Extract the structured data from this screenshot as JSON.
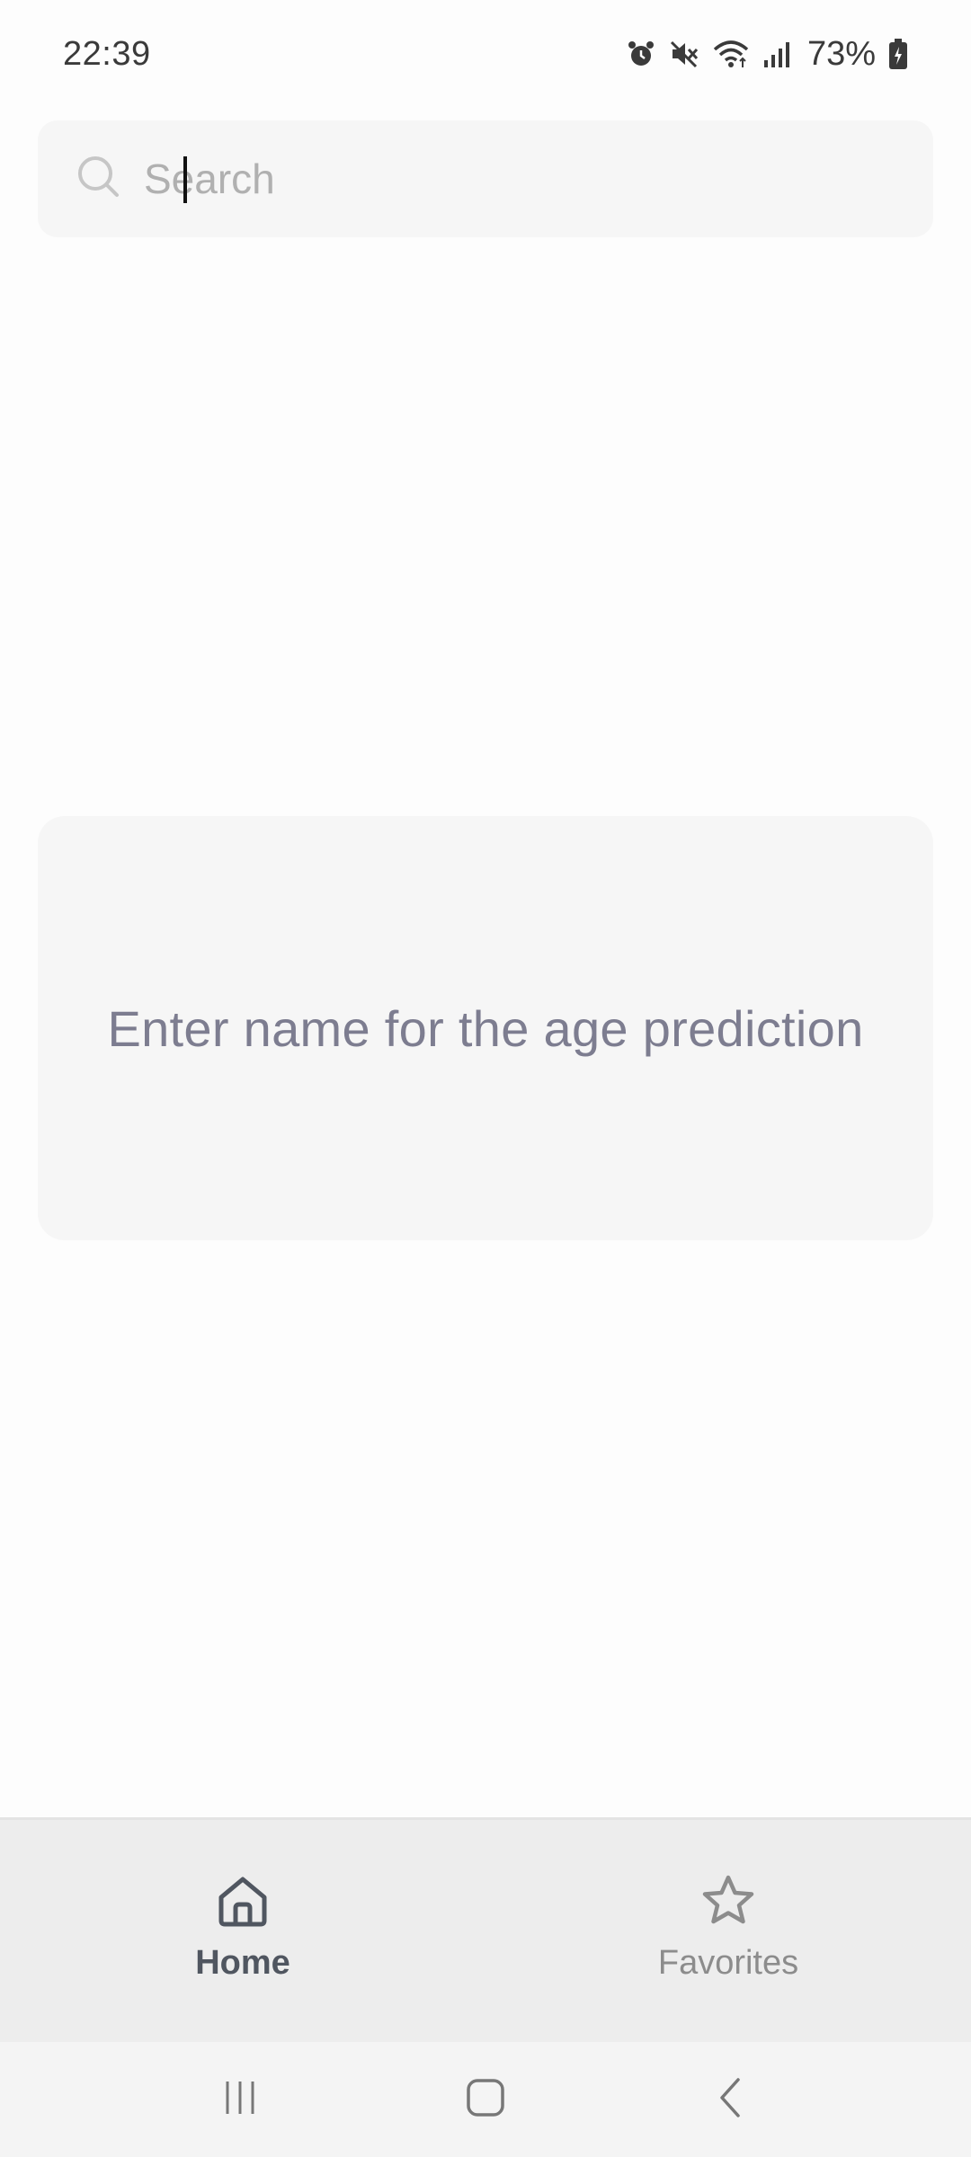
{
  "status_bar": {
    "time": "22:39",
    "battery": "73%",
    "icons": [
      "alarm-icon",
      "mute-icon",
      "wifi-icon",
      "signal-icon",
      "battery-icon"
    ]
  },
  "search": {
    "placeholder": "Search",
    "value": ""
  },
  "info_card": {
    "text": "Enter name for the age prediction"
  },
  "bottom_nav": {
    "items": [
      {
        "label": "Home",
        "icon": "home-icon",
        "active": true
      },
      {
        "label": "Favorites",
        "icon": "star-icon",
        "active": false
      }
    ]
  },
  "system_nav": {
    "buttons": [
      "recents-icon",
      "home-button-icon",
      "back-icon"
    ]
  },
  "colors": {
    "background": "#fdfdfd",
    "card": "#f6f6f6",
    "nav": "#ededed",
    "active": "#505660",
    "inactive": "#8c8c8c",
    "info_text": "#7d7d90"
  }
}
